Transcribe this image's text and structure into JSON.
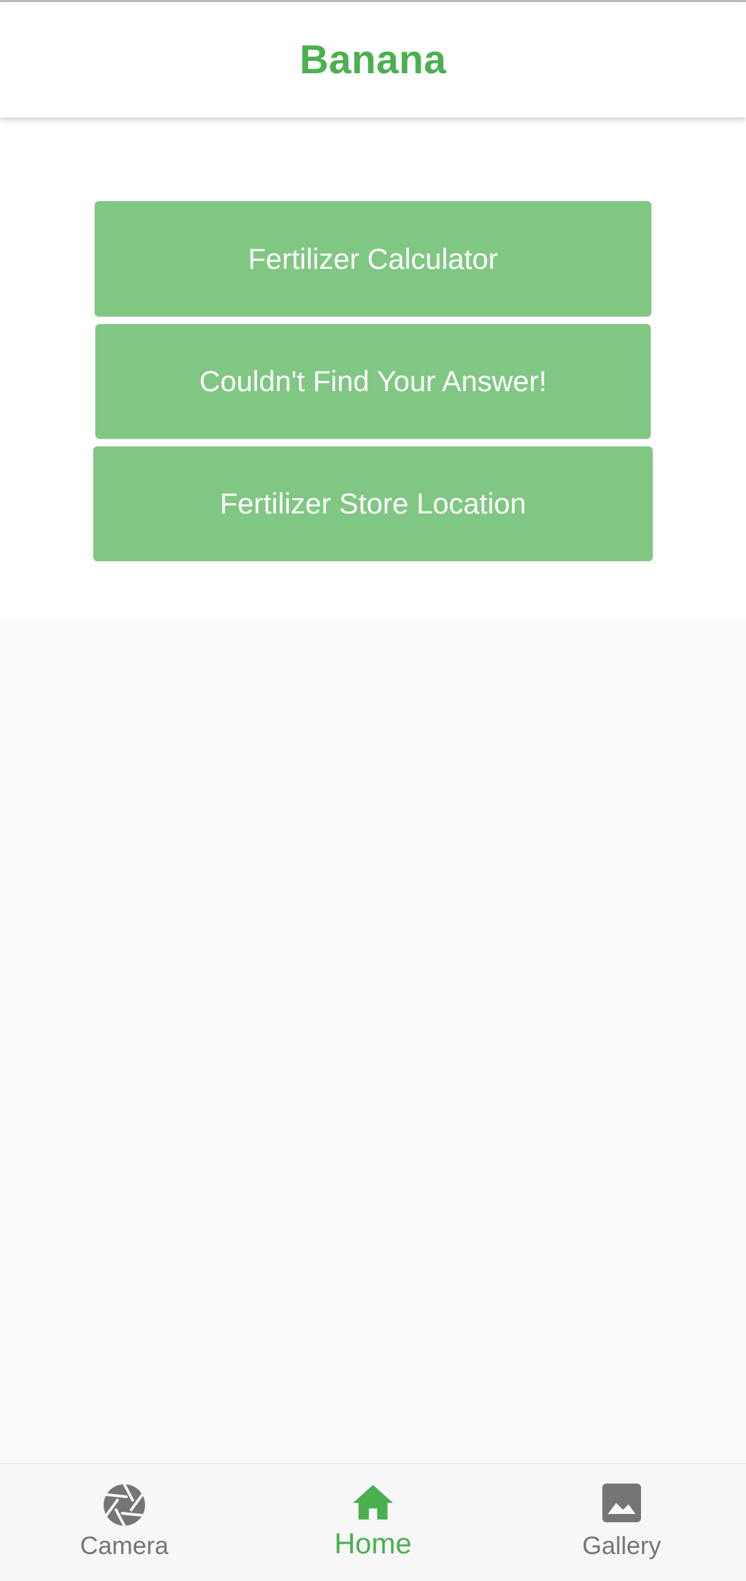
{
  "colors": {
    "accent": "#4caf50",
    "button_bg": "#81c784",
    "button_text": "#ffffff",
    "inactive": "#757575"
  },
  "app_bar": {
    "title": "Banana"
  },
  "actions": [
    {
      "label": "Fertilizer Calculator"
    },
    {
      "label": "Couldn't Find Your Answer!"
    },
    {
      "label": "Fertilizer Store Location"
    }
  ],
  "bottom_nav": {
    "selected": "Home",
    "items": [
      {
        "label": "Camera",
        "icon": "camera-shutter-icon"
      },
      {
        "label": "Home",
        "icon": "home-icon"
      },
      {
        "label": "Gallery",
        "icon": "gallery-image-icon"
      }
    ]
  }
}
